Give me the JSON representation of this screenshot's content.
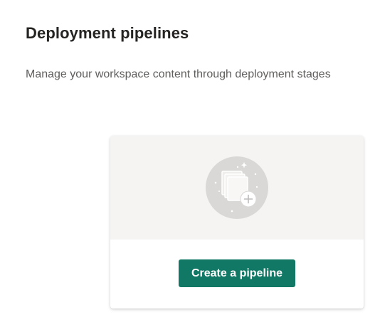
{
  "header": {
    "title": "Deployment pipelines",
    "subtitle": "Manage your workspace content through deployment stages"
  },
  "card": {
    "illustration_icon": "stacked-pages-add-icon",
    "create_button_label": "Create a pipeline"
  },
  "colors": {
    "accent": "#117865",
    "illustration_bg": "#f5f4f3",
    "illustration_circle": "#d9d8d7"
  }
}
